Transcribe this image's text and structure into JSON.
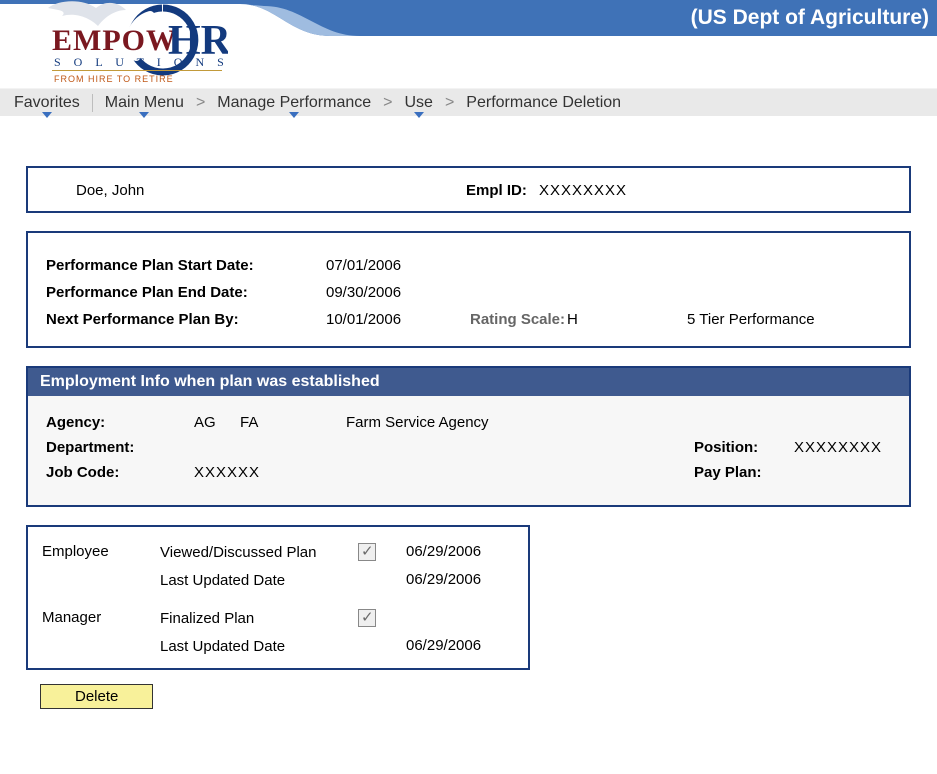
{
  "header": {
    "department": "(US Dept of Agriculture)",
    "logo_top": "EMPOW",
    "logo_top2": "HR",
    "logo_sub": "S O L U T I O N S",
    "logo_tag": "FROM HIRE TO RETIRE"
  },
  "nav": {
    "favorites": "Favorites",
    "main_menu": "Main Menu",
    "crumbs": [
      "Manage Performance",
      "Use",
      "Performance Deletion"
    ],
    "separator": ">"
  },
  "employee": {
    "name": "Doe, John",
    "empl_id_label": "Empl ID:",
    "empl_id": "XXXXXXXX"
  },
  "plan": {
    "start_label": "Performance Plan Start Date:",
    "start_date": "07/01/2006",
    "end_label": "Performance Plan End Date:",
    "end_date": "09/30/2006",
    "next_label": "Next Performance Plan By:",
    "next_date": "10/01/2006",
    "rating_label": "Rating Scale:",
    "rating_code": "H",
    "rating_desc": "5 Tier Performance"
  },
  "employment": {
    "header": "Employment Info when plan was established",
    "agency_label": "Agency:",
    "agency_code1": "AG",
    "agency_code2": "FA",
    "agency_desc": "Farm Service Agency",
    "department_label": "Department:",
    "department_value": "",
    "position_label": "Position:",
    "position_value": "XXXXXXXX",
    "job_code_label": "Job Code:",
    "job_code_value": "XXXXXX",
    "pay_plan_label": "Pay Plan:",
    "pay_plan_value": ""
  },
  "review": {
    "employee_role": "Employee",
    "employee_row1_label": "Viewed/Discussed Plan",
    "employee_row1_checked": true,
    "employee_row1_date": "06/29/2006",
    "employee_row2_label": "Last Updated Date",
    "employee_row2_date": "06/29/2006",
    "manager_role": "Manager",
    "manager_row1_label": "Finalized Plan",
    "manager_row1_checked": true,
    "manager_row1_date": "",
    "manager_row2_label": "Last Updated Date",
    "manager_row2_date": "06/29/2006"
  },
  "buttons": {
    "delete": "Delete"
  }
}
